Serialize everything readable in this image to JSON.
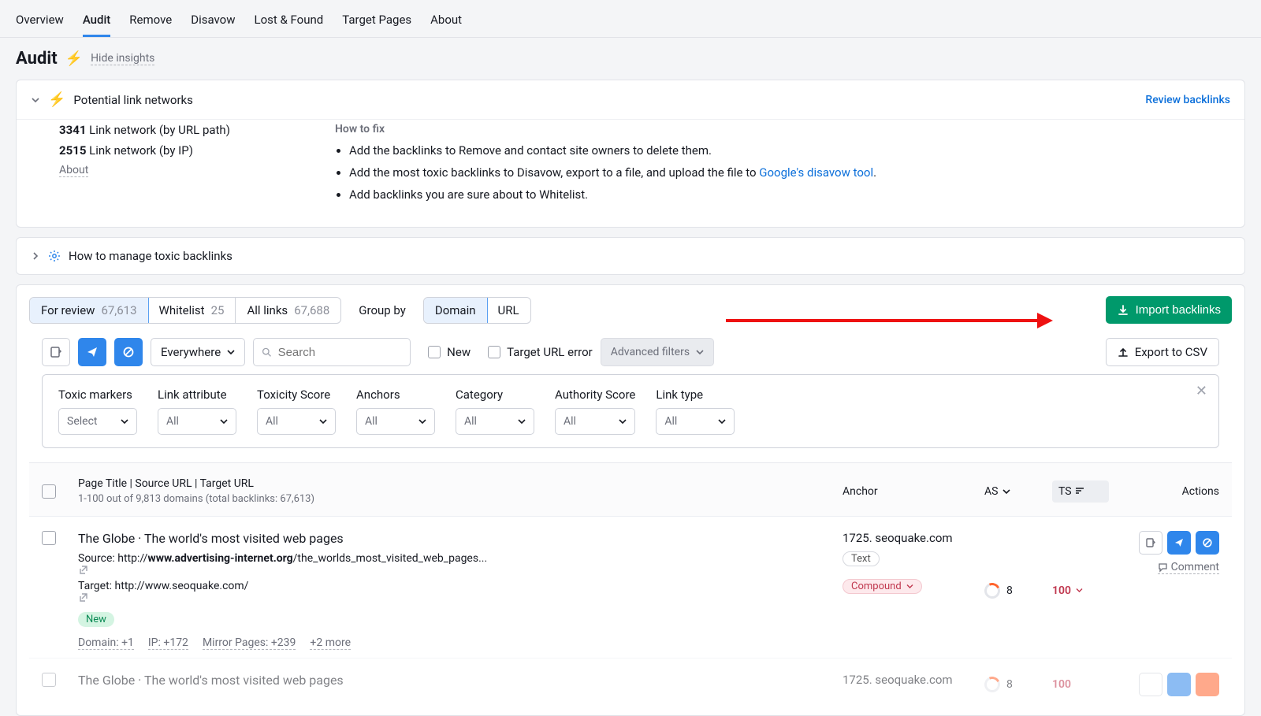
{
  "nav": {
    "items": [
      "Overview",
      "Audit",
      "Remove",
      "Disavow",
      "Lost & Found",
      "Target Pages",
      "About"
    ],
    "active": 1
  },
  "page": {
    "title": "Audit",
    "hide_insights": "Hide insights"
  },
  "insight": {
    "title": "Potential link networks",
    "review": "Review backlinks",
    "m1_count": "3341",
    "m1_label": "Link network (by URL path)",
    "m2_count": "2515",
    "m2_label": "Link network (by IP)",
    "about": "About",
    "fix_title": "How to fix",
    "fix1": "Add the backlinks to Remove and contact site owners to delete them.",
    "fix2a": "Add the most toxic backlinks to Disavow, export to a file, and upload the file to ",
    "fix2b": "Google's disavow tool",
    "fix2c": ".",
    "fix3": "Add backlinks you are sure about to Whitelist."
  },
  "howto": {
    "title": "How to manage toxic backlinks"
  },
  "segments": {
    "review_label": "For review",
    "review_count": "67,613",
    "whitelist_label": "Whitelist",
    "whitelist_count": "25",
    "all_label": "All links",
    "all_count": "67,688",
    "group_by": "Group by",
    "domain": "Domain",
    "url": "URL",
    "import": "Import backlinks"
  },
  "filters": {
    "everywhere": "Everywhere",
    "search_ph": "Search",
    "new": "New",
    "target_err": "Target URL error",
    "adv": "Advanced filters",
    "export": "Export to CSV",
    "cols": [
      "Toxic markers",
      "Link attribute",
      "Toxicity Score",
      "Anchors",
      "Category",
      "Authority Score",
      "Link type"
    ],
    "select": "Select",
    "all": "All"
  },
  "table": {
    "h_main": "Page Title | Source URL | Target URL",
    "h_sub": "1-100 out of 9,813 domains (total backlinks: 67,613)",
    "h_anchor": "Anchor",
    "h_as": "AS",
    "h_ts": "TS",
    "h_actions": "Actions"
  },
  "row": {
    "title": "The Globe · The world's most visited web pages",
    "src_lbl": "Source: ",
    "src_pre": "http://",
    "src_bold": "www.advertising-internet.org",
    "src_rest": "/the_worlds_most_visited_web_pages...",
    "tgt_lbl": "Target: ",
    "tgt_url": "http://www.seoquake.com/",
    "new": "New",
    "chip1": "Domain: +1",
    "chip2": "IP: +172",
    "chip3": "Mirror Pages: +239",
    "chip4": "+2 more",
    "anchor": "1725. seoquake.com",
    "tag_text": "Text",
    "tag_compound": "Compound",
    "as": "8",
    "ts": "100",
    "comment": "Comment"
  }
}
